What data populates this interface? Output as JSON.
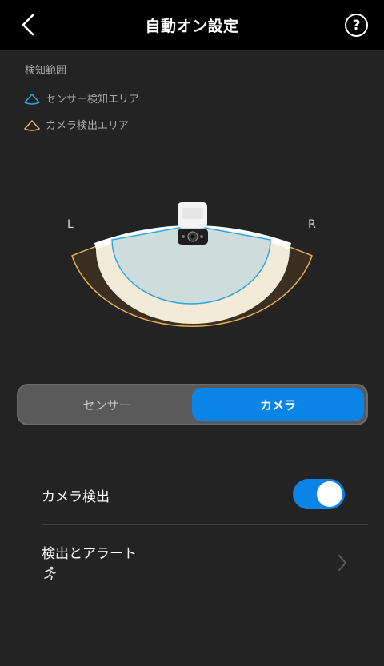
{
  "header": {
    "title": "自動オン設定",
    "back_icon": "chevron-left-icon",
    "help_label": "?"
  },
  "detection": {
    "section_title": "検知範囲",
    "legend": {
      "sensor": {
        "label": "センサー検知エリア",
        "color": "#2aa7e6"
      },
      "camera": {
        "label": "カメラ検出エリア",
        "color": "#e9b04c"
      }
    },
    "left_label": "L",
    "right_label": "R"
  },
  "segmented": {
    "sensor_label": "センサー",
    "camera_label": "カメラ",
    "selected": "camera"
  },
  "settings": {
    "camera_detection": {
      "label": "カメラ検出",
      "enabled": true
    },
    "detection_alert": {
      "label": "検出とアラート",
      "icon": "running-person-icon",
      "chevron": "chevron-right-icon"
    }
  },
  "colors": {
    "accent": "#0a84e6",
    "background": "#232323",
    "header": "#000000"
  }
}
